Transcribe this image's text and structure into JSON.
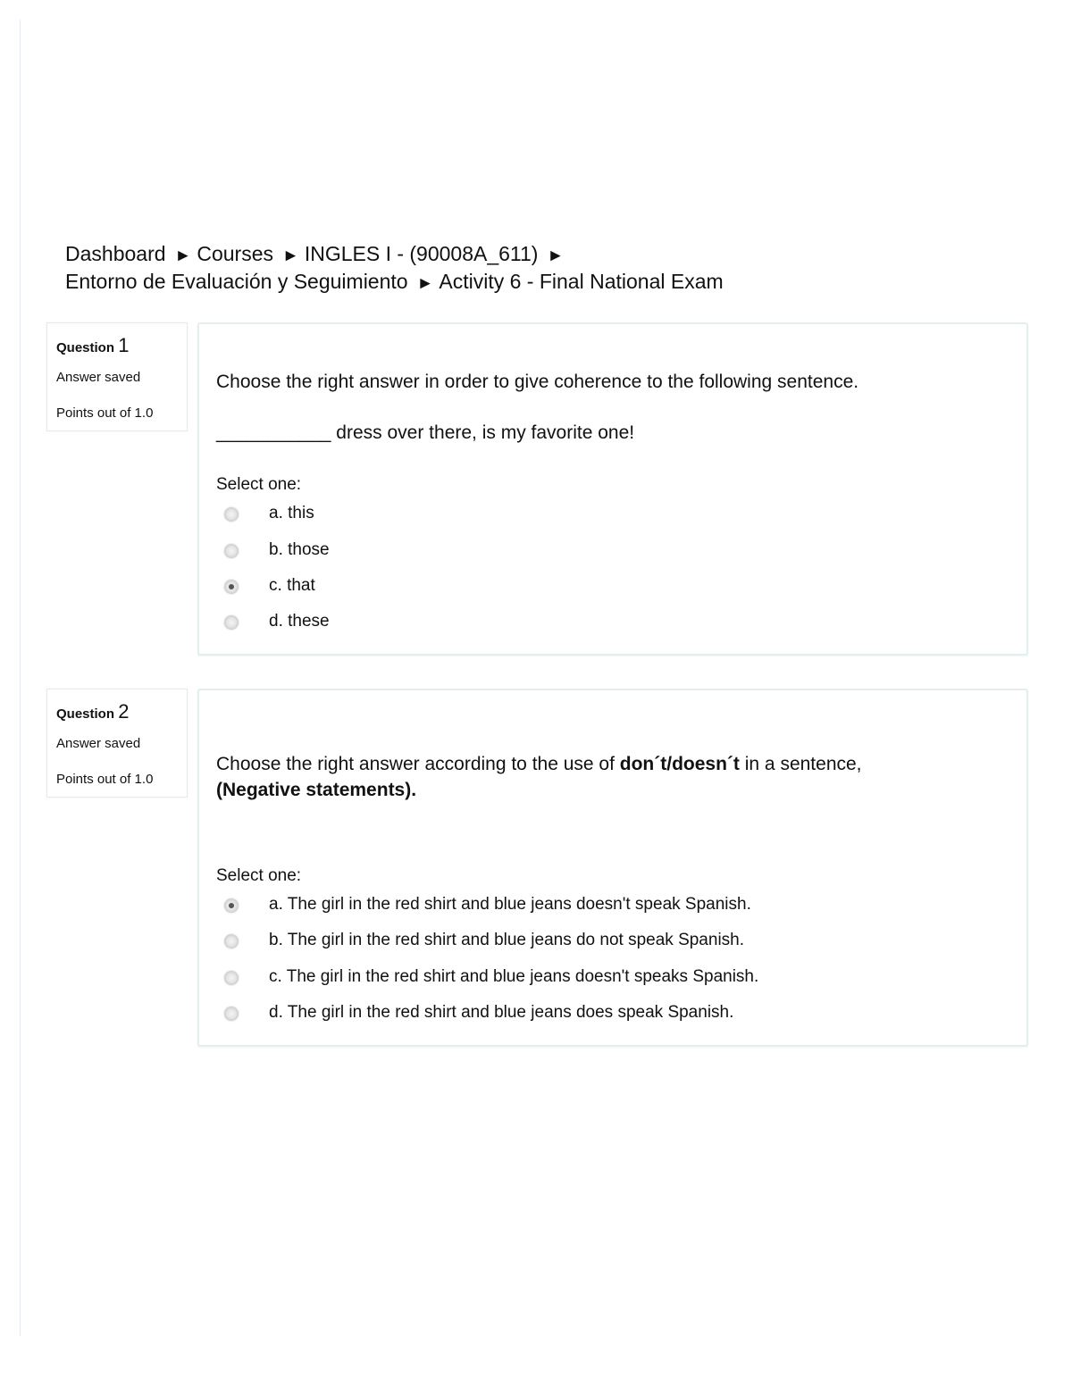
{
  "breadcrumb": {
    "items": [
      "Dashboard",
      "Courses",
      "INGLES I - (90008A_611)",
      "Entorno de Evaluación y Seguimiento",
      "Activity 6 - Final National Exam"
    ],
    "separator": "►"
  },
  "questions": [
    {
      "label": "Question",
      "number": "1",
      "state": "Answer saved",
      "grade": "Points out of 1.0",
      "text_line1": "Choose the right answer in order to give coherence to the following sentence.",
      "text_line2": "___________ dress over there, is my favorite one!",
      "prompt": "Select one:",
      "answers": [
        {
          "letter": "a.",
          "text": "this",
          "checked": false
        },
        {
          "letter": "b.",
          "text": "those",
          "checked": false
        },
        {
          "letter": "c.",
          "text": "that",
          "checked": true
        },
        {
          "letter": "d.",
          "text": "these",
          "checked": false
        }
      ]
    },
    {
      "label": "Question",
      "number": "2",
      "state": "Answer saved",
      "grade": "Points out of 1.0",
      "text_part1": "Choose the right answer according to the use of ",
      "text_bold1": "don´t/doesn´t",
      "text_part2": " in a sentence,",
      "text_bold2": "(Negative statements).",
      "prompt": "Select one:",
      "answers": [
        {
          "letter": "a.",
          "text": "The girl in the red shirt and blue jeans doesn't speak Spanish.",
          "checked": true
        },
        {
          "letter": "b.",
          "text": "The girl in the red shirt and blue jeans do not speak Spanish.",
          "checked": false
        },
        {
          "letter": "c.",
          "text": "The girl in the red shirt and blue jeans doesn't speaks Spanish.",
          "checked": false
        },
        {
          "letter": "d.",
          "text": "The girl in the red shirt and blue jeans does speak Spanish.",
          "checked": false
        }
      ]
    }
  ]
}
